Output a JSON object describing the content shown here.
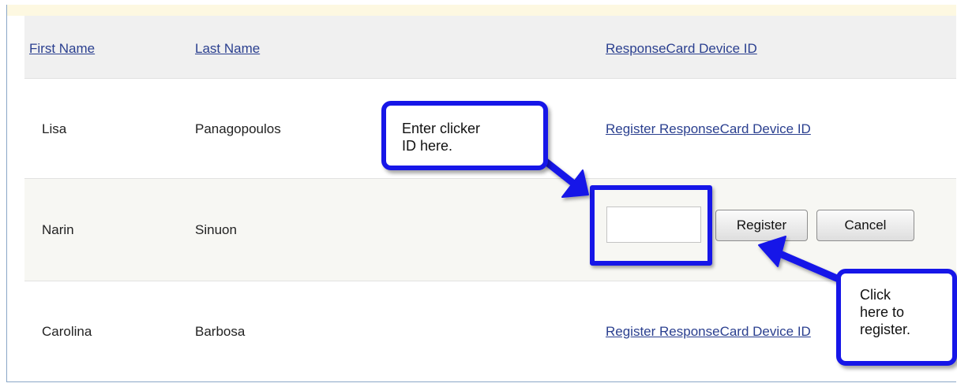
{
  "table": {
    "headers": {
      "first_name": "First Name",
      "last_name": "Last Name",
      "device_id": "ResponseCard Device ID"
    },
    "rows": [
      {
        "first_name": "Lisa",
        "last_name": "Panagopoulos",
        "device_link": "Register ResponseCard Device ID"
      },
      {
        "first_name": "Narin",
        "last_name": "Sinuon",
        "device_input": {
          "value": "",
          "placeholder": ""
        },
        "register_label": "Register",
        "cancel_label": "Cancel"
      },
      {
        "first_name": "Carolina",
        "last_name": "Barbosa",
        "device_link": "Register ResponseCard Device ID"
      }
    ]
  },
  "callouts": {
    "enter_id": "Enter clicker\nID here.",
    "click_register": "Click\nhere to\nregister."
  },
  "colors": {
    "annotation_blue": "#1616e8",
    "link": "#2a3f8f",
    "header_bg": "#f0f0f0",
    "alt_row_bg": "#f7f7f3"
  }
}
